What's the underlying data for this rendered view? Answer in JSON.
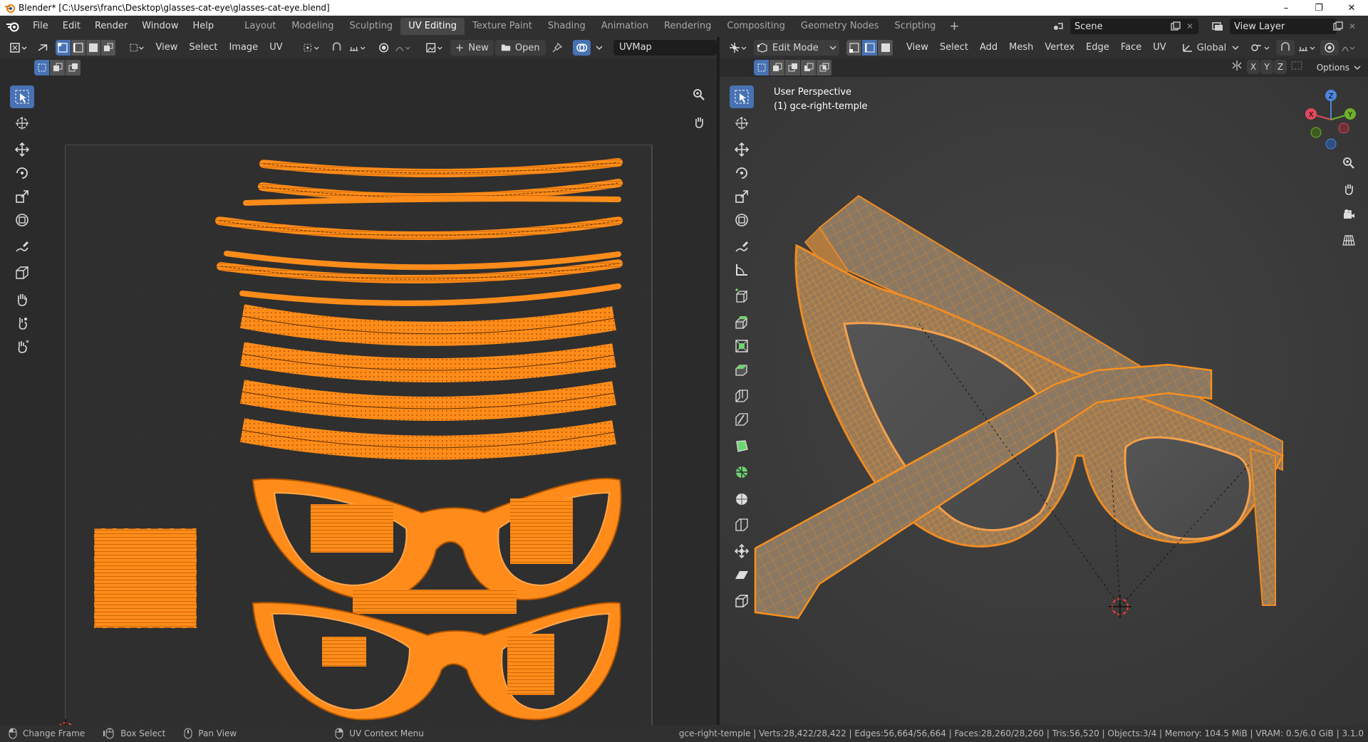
{
  "window": {
    "title": "Blender* [C:\\Users\\franc\\Desktop\\glasses-cat-eye\\glasses-cat-eye.blend]",
    "controls": [
      "–",
      "❐",
      "✕"
    ]
  },
  "menu": [
    "File",
    "Edit",
    "Render",
    "Window",
    "Help"
  ],
  "workspaces": [
    "Layout",
    "Modeling",
    "Sculpting",
    "UV Editing",
    "Texture Paint",
    "Shading",
    "Animation",
    "Rendering",
    "Compositing",
    "Geometry Nodes",
    "Scripting"
  ],
  "active_workspace": "UV Editing",
  "scene": {
    "name": "Scene",
    "view_layer": "View Layer"
  },
  "uv_editor": {
    "menus": [
      "View",
      "Select",
      "Image",
      "UV"
    ],
    "new_label": "New",
    "open_label": "Open",
    "uvmap": "UVMap"
  },
  "viewport": {
    "mode": "Edit Mode",
    "menus": [
      "View",
      "Select",
      "Add",
      "Mesh",
      "Vertex",
      "Edge",
      "Face",
      "UV"
    ],
    "orientation": "Global",
    "options_label": "Options",
    "axis_lock": [
      "X",
      "Y",
      "Z"
    ],
    "overlay_title": "User Perspective",
    "overlay_object": "(1) gce-right-temple",
    "gizmo_axes": [
      "X",
      "Y",
      "Z"
    ]
  },
  "status": {
    "hints": [
      "Change Frame",
      "Box Select",
      "Pan View",
      "UV Context Menu"
    ],
    "stats": "gce-right-temple | Verts:28,422/28,422 | Edges:56,664/56,664 | Faces:28,260/28,260 | Tris:56,520 | Objects:3/4 | Memory: 104.5 MiB | VRAM: 0.5/6.0 GiB | 3.1.0"
  },
  "colors": {
    "accent": "#4772b3",
    "uv_orange": "#ff8c1a",
    "wire_orange": "#f08c23",
    "background": "#2b2b2b",
    "header": "#303030"
  },
  "icons": {
    "uv_tools": [
      "select-box-icon",
      "cursor-icon",
      "move-icon",
      "rotate-icon",
      "scale-icon",
      "transform-icon",
      "annotate-icon",
      "rip-icon",
      "grab-icon",
      "relax-icon",
      "pinch-icon"
    ],
    "viewport_tools": [
      "select-box-icon",
      "cursor-icon",
      "move-icon",
      "rotate-icon",
      "scale-icon",
      "transform-icon",
      "annotate-icon",
      "measure-icon",
      "add-cube-icon",
      "extrude-icon",
      "inset-icon",
      "bevel-icon",
      "loop-cut-icon",
      "knife-icon",
      "poly-build-icon",
      "spin-icon",
      "smooth-icon",
      "edge-slide-icon",
      "shrink-fatten-icon",
      "shear-icon",
      "rip-region-icon"
    ]
  }
}
